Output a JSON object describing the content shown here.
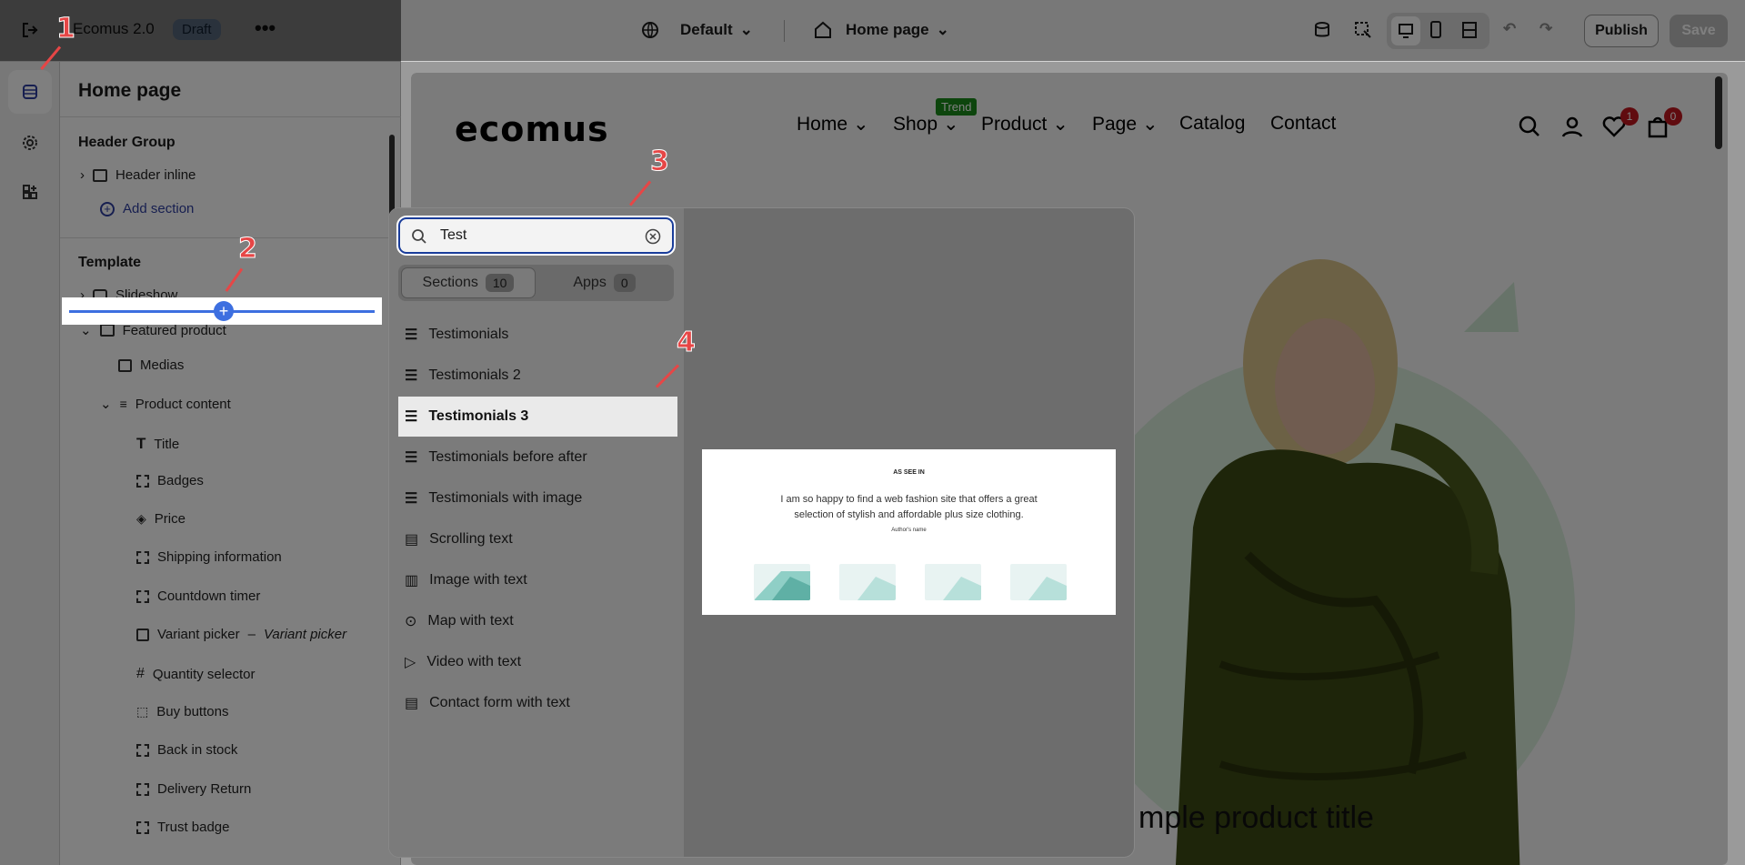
{
  "topbar": {
    "store_name": "Ecomus 2.0",
    "status_badge": "Draft",
    "theme_label": "Default",
    "page_label": "Home page",
    "publish_label": "Publish",
    "save_label": "Save"
  },
  "left_panel": {
    "title": "Home page",
    "header_group_title": "Header Group",
    "header_items": [
      "Header inline"
    ],
    "add_section_label": "Add section",
    "template_title": "Template",
    "template_items": [
      {
        "label": "Slideshow"
      },
      {
        "label": "Featured product"
      },
      {
        "label": "Medias"
      },
      {
        "label": "Product content"
      },
      {
        "label": "Title"
      },
      {
        "label": "Badges"
      },
      {
        "label": "Price"
      },
      {
        "label": "Shipping information"
      },
      {
        "label": "Countdown timer"
      },
      {
        "label": "Variant picker",
        "suffix": "Variant picker"
      },
      {
        "label": "Quantity selector"
      },
      {
        "label": "Buy buttons"
      },
      {
        "label": "Back in stock"
      },
      {
        "label": "Delivery Return"
      },
      {
        "label": "Trust badge"
      }
    ]
  },
  "storefront": {
    "logo": "ecomus",
    "nav": [
      "Home",
      "Shop",
      "Product",
      "Page",
      "Catalog",
      "Contact"
    ],
    "trend_badge": "Trend",
    "wishlist_count": "1",
    "cart_count": "0",
    "product_title": "mple product title"
  },
  "popup": {
    "search_value": "Test",
    "tabs": [
      {
        "label": "Sections",
        "count": "10"
      },
      {
        "label": "Apps",
        "count": "0"
      }
    ],
    "items": [
      "Testimonials",
      "Testimonials 2",
      "Testimonials 3",
      "Testimonials before after",
      "Testimonials with image",
      "Scrolling text",
      "Image with text",
      "Map with text",
      "Video with text",
      "Contact form with text"
    ],
    "selected_index": 2,
    "preview": {
      "heading": "AS SEE IN",
      "quote": "I am so happy to find a web fashion site that offers a great selection of stylish and affordable plus size clothing.",
      "author": "Author's name"
    }
  },
  "annotations": [
    "1",
    "2",
    "3",
    "4"
  ],
  "colors": {
    "accent": "#3d6fe0",
    "annotation": "#e64646",
    "trend": "#1a8a1a",
    "badge_red": "#c0161e"
  }
}
